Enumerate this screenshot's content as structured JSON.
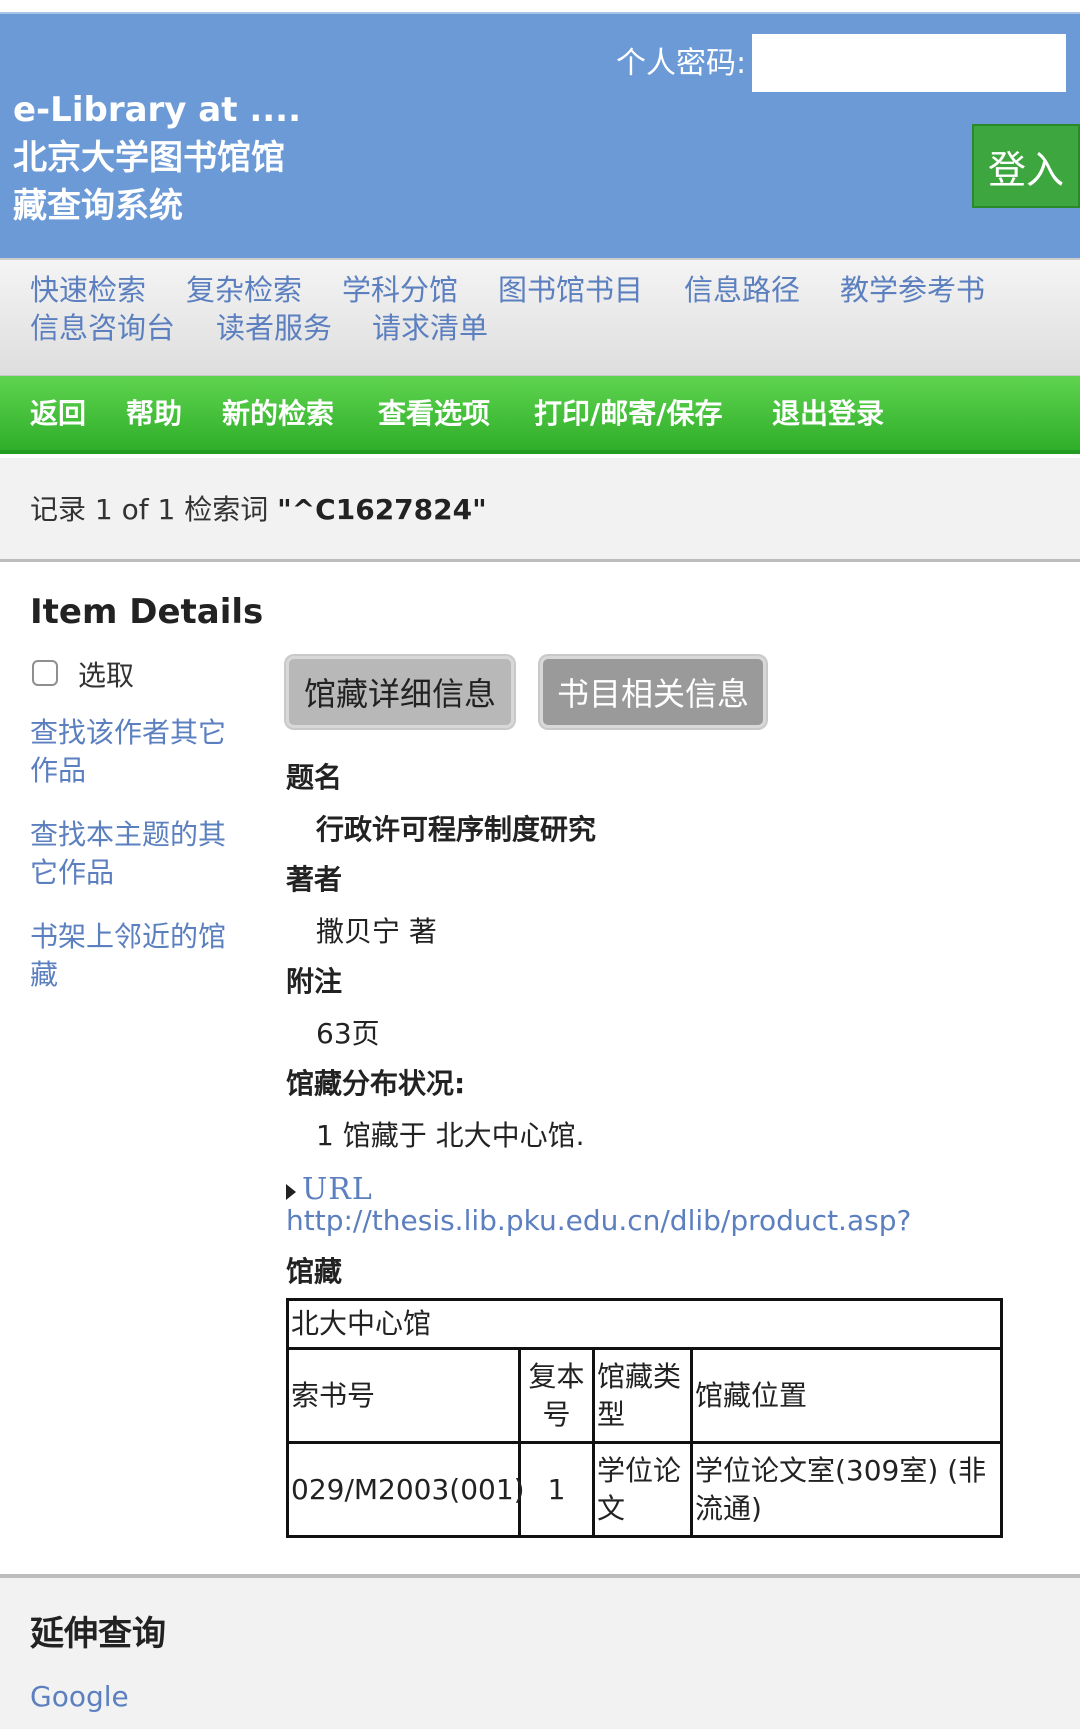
{
  "header": {
    "brand": "e-Library at .... 北京大学图书馆馆藏查询系统",
    "password_label": "个人密码:",
    "password_value": "",
    "login_label": "登入"
  },
  "nav_primary": [
    "快速检索",
    "复杂检索",
    "学科分馆",
    "图书馆书目",
    "信息路径",
    "教学参考书",
    "信息咨询台",
    "读者服务",
    "请求清单"
  ],
  "nav_secondary": [
    "返回",
    "帮助",
    "新的检索",
    "查看选项",
    "打印/邮寄/保存",
    "退出登录"
  ],
  "record": {
    "prefix": "记录 1 of 1 检索词 ",
    "term": "\"^C1627824\""
  },
  "item": {
    "heading": "Item Details",
    "select_label": "选取",
    "side_links": [
      "查找该作者其它作品",
      "查找本主题的其它作品",
      "书架上邻近的馆藏"
    ],
    "tabs": [
      "馆藏详细信息",
      "书目相关信息"
    ],
    "fields": {
      "title_label": "题名",
      "title_value": "行政许可程序制度研究",
      "author_label": "著者",
      "author_value": "撒贝宁 著",
      "note_label": "附注",
      "note_value": "63页",
      "distribution_label": "馆藏分布状况:",
      "distribution_value": "1 馆藏于 北大中心馆."
    },
    "url_label": "URL",
    "url_link": "http://thesis.lib.pku.edu.cn/dlib/product.asp?",
    "holdings_label": "馆藏",
    "holdings": {
      "library": "北大中心馆",
      "headers": [
        "索书号",
        "复本号",
        "馆藏类型",
        "馆藏位置"
      ],
      "rows": [
        [
          "029/M2003(001)",
          "1",
          "学位论文",
          "学位论文室(309室) (非流通)"
        ]
      ]
    }
  },
  "extended": {
    "heading": "延伸查询",
    "google": "Google"
  }
}
